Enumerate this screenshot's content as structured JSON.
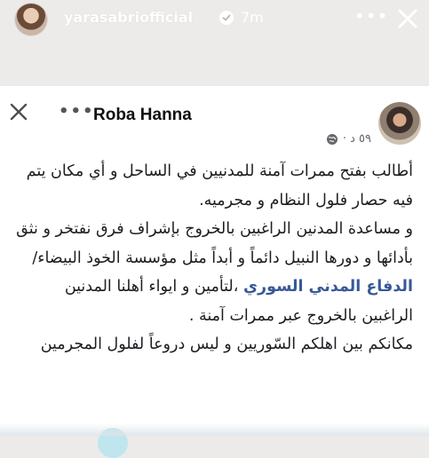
{
  "story": {
    "username": "yarasabriofficial",
    "time": "7m",
    "more_label": "•••",
    "verified_icon": "verified-badge-icon",
    "close_icon": "close-icon"
  },
  "fb_post": {
    "author": "Roba Hanna",
    "more_label": "•••",
    "time_label": "٥٩ د ·",
    "privacy_icon": "globe-icon",
    "paragraphs": [
      "أطالب بفتح ممرات آمنة للمدنيين في الساحل و أي مكان يتم فيه حصار فلول النظام و مجرميه.",
      "و مساعدة المدنين الراغبين بالخروج بإشراف فرق نفتخر و نثق بأدائها و دورها النبيل دائماً و أبداً مثل مؤسسة الخوذ البيضاء/"
    ],
    "org_link": "الدفاع المدني السوري",
    "paragraph_after_link": "،لتأمين و ايواء أهلنا المدنين الراغبين بالخروج عبر ممرات آمنة .",
    "paragraph_last": "مكانكم بين اهلكم السّوريين و ليس دروعاً لفلول المجرمين"
  }
}
